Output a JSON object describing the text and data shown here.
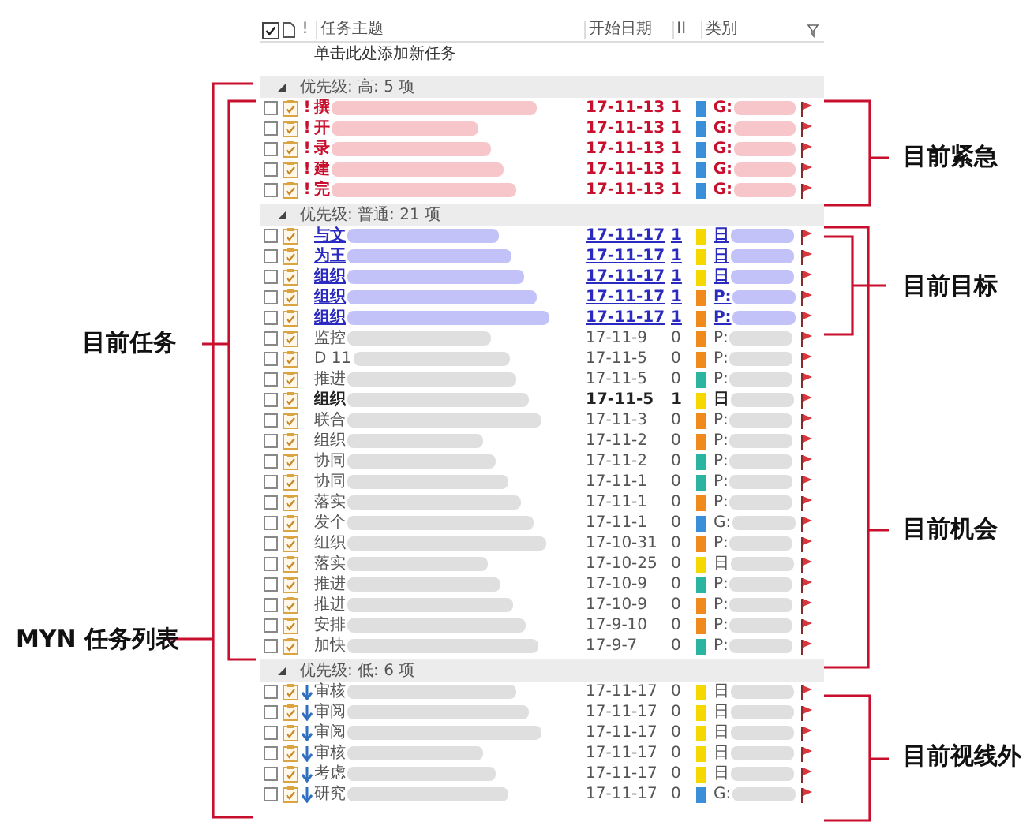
{
  "header": {
    "checked": true,
    "importance": "!",
    "subject": "任务主题",
    "start_date": "开始日期",
    "column_4": "II",
    "category": "类别"
  },
  "new_task_placeholder": "单击此处添加新任务",
  "groups": [
    {
      "label": "优先级: 高: 5 项",
      "expanded": true,
      "rows": [
        {
          "checked": false,
          "kind": "urgent",
          "mark": "!",
          "subject": "撰",
          "date": "17-11-13",
          "count": "1",
          "category": "G:",
          "color": "#3b8fd9"
        },
        {
          "checked": false,
          "kind": "urgent",
          "mark": "!",
          "subject": "开",
          "date": "17-11-13",
          "count": "1",
          "category": "G:",
          "color": "#3b8fd9"
        },
        {
          "checked": false,
          "kind": "urgent",
          "mark": "!",
          "subject": "录",
          "date": "17-11-13",
          "count": "1",
          "category": "G:",
          "color": "#3b8fd9"
        },
        {
          "checked": false,
          "kind": "urgent",
          "mark": "!",
          "subject": "建",
          "date": "17-11-13",
          "count": "1",
          "category": "G:",
          "color": "#3b8fd9"
        },
        {
          "checked": false,
          "kind": "urgent",
          "mark": "!",
          "subject": "完",
          "date": "17-11-13",
          "count": "1",
          "category": "G:",
          "color": "#3b8fd9"
        }
      ]
    },
    {
      "label": "优先级: 普通: 21 项",
      "expanded": true,
      "rows": [
        {
          "checked": false,
          "kind": "goal",
          "subject": "与文",
          "date": "17-11-17",
          "count": "1",
          "category": "日",
          "color": "#f5d800"
        },
        {
          "checked": false,
          "kind": "goal",
          "subject": "为王",
          "date": "17-11-17",
          "count": "1",
          "category": "日",
          "color": "#f5d800"
        },
        {
          "checked": false,
          "kind": "goal",
          "subject": "组织",
          "date": "17-11-17",
          "count": "1",
          "category": "日",
          "color": "#f5d800"
        },
        {
          "checked": false,
          "kind": "goal",
          "subject": "组织",
          "date": "17-11-17",
          "count": "1",
          "category": "P:",
          "color": "#f08a1c"
        },
        {
          "checked": false,
          "kind": "goal",
          "subject": "组织",
          "date": "17-11-17",
          "count": "1",
          "category": "P:",
          "color": "#f08a1c"
        },
        {
          "checked": false,
          "kind": "plain",
          "subject": "监控",
          "date": "17-11-9",
          "count": "0",
          "category": "P:",
          "color": "#f08a1c"
        },
        {
          "checked": false,
          "kind": "plain",
          "subject": "D 11",
          "date": "17-11-5",
          "count": "0",
          "category": "P:",
          "color": "#f08a1c"
        },
        {
          "checked": false,
          "kind": "plain",
          "subject": "推进",
          "date": "17-11-5",
          "count": "0",
          "category": "P:",
          "color": "#2bb5a0"
        },
        {
          "checked": false,
          "kind": "bold",
          "subject": "组织",
          "date": "17-11-5",
          "count": "1",
          "category": "日",
          "color": "#f5d800"
        },
        {
          "checked": false,
          "kind": "plain",
          "subject": "联合",
          "date": "17-11-3",
          "count": "0",
          "category": "P:",
          "color": "#f08a1c"
        },
        {
          "checked": false,
          "kind": "plain",
          "subject": "组织",
          "date": "17-11-2",
          "count": "0",
          "category": "P:",
          "color": "#f08a1c"
        },
        {
          "checked": false,
          "kind": "plain",
          "subject": "协同",
          "date": "17-11-2",
          "count": "0",
          "category": "P:",
          "color": "#2bb5a0"
        },
        {
          "checked": false,
          "kind": "plain",
          "subject": "协同",
          "date": "17-11-1",
          "count": "0",
          "category": "P:",
          "color": "#2bb5a0"
        },
        {
          "checked": false,
          "kind": "plain",
          "subject": "落实",
          "date": "17-11-1",
          "count": "0",
          "category": "P:",
          "color": "#f08a1c"
        },
        {
          "checked": false,
          "kind": "plain",
          "subject": "发个",
          "date": "17-11-1",
          "count": "0",
          "category": "G:",
          "color": "#3b8fd9"
        },
        {
          "checked": false,
          "kind": "plain",
          "subject": "组织",
          "date": "17-10-31",
          "count": "0",
          "category": "P:",
          "color": "#f08a1c"
        },
        {
          "checked": false,
          "kind": "plain",
          "subject": "落实",
          "date": "17-10-25",
          "count": "0",
          "category": "日",
          "color": "#f5d800"
        },
        {
          "checked": false,
          "kind": "plain",
          "subject": "推进",
          "date": "17-10-9",
          "count": "0",
          "category": "P:",
          "color": "#2bb5a0"
        },
        {
          "checked": false,
          "kind": "plain",
          "subject": "推进",
          "date": "17-10-9",
          "count": "0",
          "category": "P:",
          "color": "#f08a1c"
        },
        {
          "checked": false,
          "kind": "plain",
          "subject": "安排",
          "date": "17-9-10",
          "count": "0",
          "category": "P:",
          "color": "#f08a1c"
        },
        {
          "checked": false,
          "kind": "plain",
          "subject": "加快",
          "date": "17-9-7",
          "count": "0",
          "category": "P:",
          "color": "#2bb5a0"
        }
      ]
    },
    {
      "label": "优先级: 低: 6 项",
      "expanded": true,
      "rows": [
        {
          "checked": false,
          "kind": "low",
          "subject": "审核",
          "date": "17-11-17",
          "count": "0",
          "category": "日",
          "color": "#f5d800"
        },
        {
          "checked": false,
          "kind": "low",
          "subject": "审阅",
          "date": "17-11-17",
          "count": "0",
          "category": "日",
          "color": "#f5d800"
        },
        {
          "checked": false,
          "kind": "low",
          "subject": "审阅",
          "date": "17-11-17",
          "count": "0",
          "category": "日",
          "color": "#f5d800"
        },
        {
          "checked": false,
          "kind": "low",
          "subject": "审核",
          "date": "17-11-17",
          "count": "0",
          "category": "日",
          "color": "#f5d800"
        },
        {
          "checked": false,
          "kind": "low",
          "subject": "考虑",
          "date": "17-11-17",
          "count": "0",
          "category": "日",
          "color": "#f5d800"
        },
        {
          "checked": false,
          "kind": "low",
          "subject": "研究",
          "date": "17-11-17",
          "count": "0",
          "category": "G:",
          "color": "#3b8fd9"
        }
      ]
    }
  ],
  "annotations": [
    {
      "label": "目前任务"
    },
    {
      "label": "MYN 任务列表"
    },
    {
      "label": "目前紧急"
    },
    {
      "label": "目前目标"
    },
    {
      "label": "目前机会"
    },
    {
      "label": "目前视线外"
    }
  ]
}
